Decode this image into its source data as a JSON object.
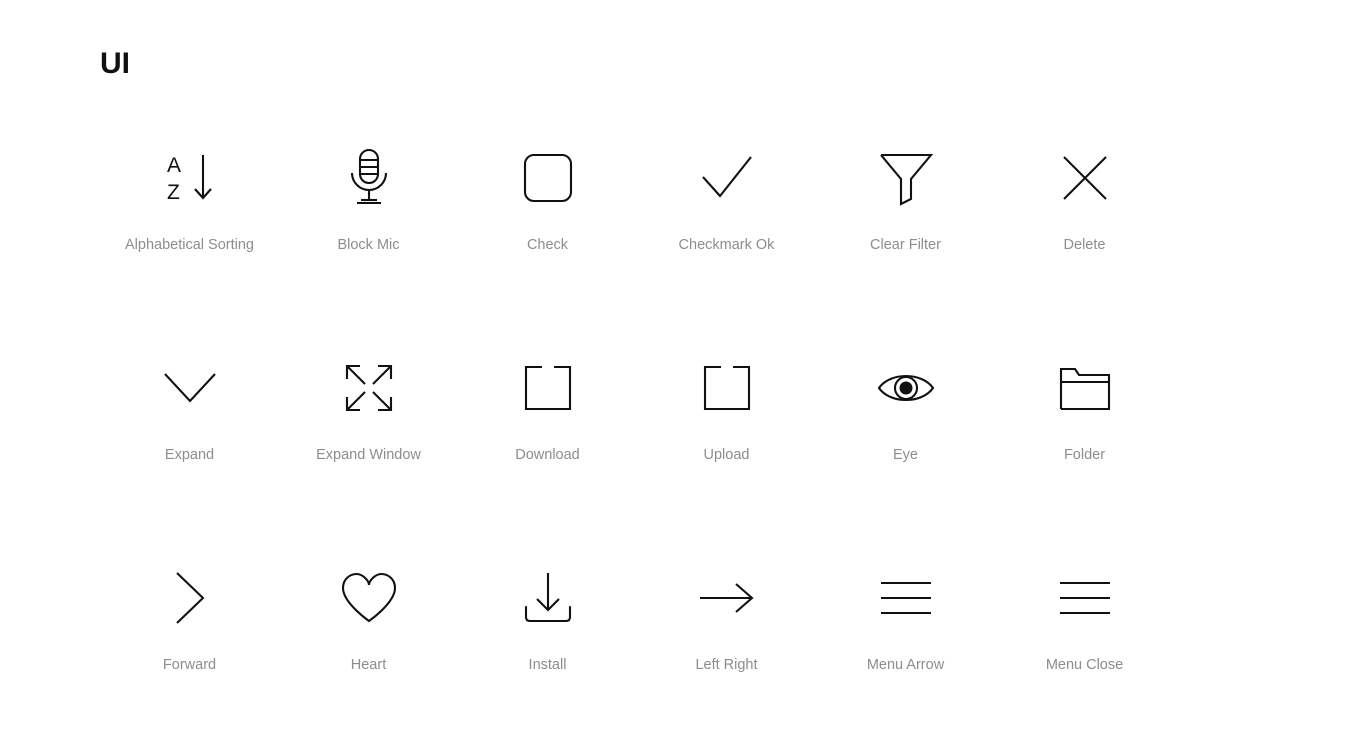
{
  "header": {
    "title": "UI"
  },
  "colors": {
    "background": "#ffffff",
    "title": "#101010",
    "icon_stroke": "#111111",
    "label": "#8d8d8d"
  },
  "grid": {
    "columns": 6,
    "rows": 3,
    "icons": [
      {
        "icon": "alphabetical-sorting-icon",
        "label": "Alphabetical Sorting"
      },
      {
        "icon": "block-mic-icon",
        "label": "Block Mic"
      },
      {
        "icon": "check-icon",
        "label": "Check"
      },
      {
        "icon": "checkmark-ok-icon",
        "label": "Checkmark Ok"
      },
      {
        "icon": "clear-filter-icon",
        "label": "Clear Filter"
      },
      {
        "icon": "delete-icon",
        "label": "Delete"
      },
      {
        "icon": "expand-icon",
        "label": "Expand"
      },
      {
        "icon": "expand-window-icon",
        "label": "Expand Window"
      },
      {
        "icon": "download-icon",
        "label": "Download"
      },
      {
        "icon": "upload-icon",
        "label": "Upload"
      },
      {
        "icon": "eye-icon",
        "label": "Eye"
      },
      {
        "icon": "folder-icon",
        "label": "Folder"
      },
      {
        "icon": "forward-icon",
        "label": "Forward"
      },
      {
        "icon": "heart-icon",
        "label": "Heart"
      },
      {
        "icon": "install-icon",
        "label": "Install"
      },
      {
        "icon": "left-right-icon",
        "label": "Left Right"
      },
      {
        "icon": "menu-arrow-icon",
        "label": "Menu Arrow"
      },
      {
        "icon": "menu-close-icon",
        "label": "Menu Close"
      }
    ]
  },
  "az_glyphs": {
    "top": "A",
    "bottom": "Z"
  }
}
